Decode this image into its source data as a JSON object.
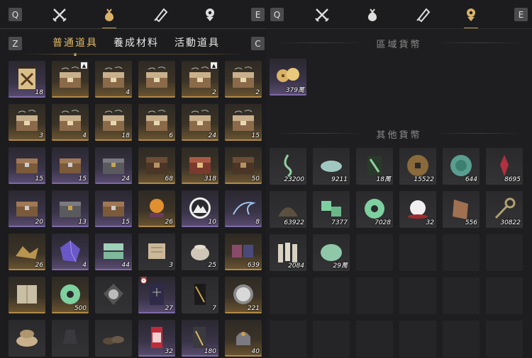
{
  "keys": {
    "prev_left": "Q",
    "next_left": "E",
    "prev_right": "Q",
    "next_right": "E",
    "sub_prev": "Z",
    "sub_next": "C"
  },
  "top_tabs": [
    {
      "icon": "crossed-swords-icon"
    },
    {
      "icon": "money-pouch-icon",
      "active": true
    },
    {
      "icon": "scroll-icon"
    },
    {
      "icon": "gem-icon"
    }
  ],
  "right_top_tabs": [
    {
      "icon": "crossed-swords-icon"
    },
    {
      "icon": "money-pouch-icon"
    },
    {
      "icon": "scroll-icon"
    },
    {
      "icon": "gem-icon",
      "active": true
    }
  ],
  "sub_tabs": [
    {
      "label": "普通道具",
      "active": true
    },
    {
      "label": "養成材料"
    },
    {
      "label": "活動道具"
    }
  ],
  "inventory": [
    [
      {
        "name": "banner",
        "rarity": "purple",
        "count": "18"
      },
      {
        "name": "chest-gold",
        "rarity": "gold",
        "count": "",
        "badge": "▲"
      },
      {
        "name": "chest-gold",
        "rarity": "gold",
        "count": "4"
      },
      {
        "name": "chest-gold",
        "rarity": "gold",
        "count": ""
      },
      {
        "name": "chest-gold",
        "rarity": "gold",
        "count": "2",
        "badge": "▲"
      },
      {
        "name": "chest-gold",
        "rarity": "gold",
        "count": "2"
      }
    ],
    [
      {
        "name": "chest-gold",
        "rarity": "gold",
        "count": "3"
      },
      {
        "name": "chest-gold",
        "rarity": "gold",
        "count": "4"
      },
      {
        "name": "chest-gold",
        "rarity": "gold",
        "count": "18"
      },
      {
        "name": "chest-gold",
        "rarity": "gold",
        "count": "6"
      },
      {
        "name": "chest-gold",
        "rarity": "gold",
        "count": "24"
      },
      {
        "name": "chest-gold",
        "rarity": "gold",
        "count": "15"
      }
    ],
    [
      {
        "name": "chest-wood",
        "rarity": "purple",
        "count": "15"
      },
      {
        "name": "chest-wood",
        "rarity": "purple",
        "count": "15"
      },
      {
        "name": "chest-iron",
        "rarity": "purple",
        "count": "24"
      },
      {
        "name": "chest-dark",
        "rarity": "gold",
        "count": "68"
      },
      {
        "name": "chest-red",
        "rarity": "gold",
        "count": "318"
      },
      {
        "name": "chest-dark",
        "rarity": "gold",
        "count": "50"
      }
    ],
    [
      {
        "name": "chest-wood",
        "rarity": "purple",
        "count": "20"
      },
      {
        "name": "chest-iron",
        "rarity": "purple",
        "count": "13"
      },
      {
        "name": "chest-wood",
        "rarity": "purple",
        "count": "15"
      },
      {
        "name": "orb",
        "rarity": "gold",
        "count": "26"
      },
      {
        "name": "mountain-emblem",
        "rarity": "purple",
        "count": "10"
      },
      {
        "name": "spirit-bird",
        "rarity": "purple",
        "count": "8"
      }
    ],
    [
      {
        "name": "gold-dust",
        "rarity": "gold",
        "count": "26"
      },
      {
        "name": "crystal",
        "rarity": "purple",
        "count": "4"
      },
      {
        "name": "boxes",
        "rarity": "purple",
        "count": "44"
      },
      {
        "name": "scroll-open",
        "rarity": "dark",
        "count": "3"
      },
      {
        "name": "jar",
        "rarity": "dark",
        "count": "25"
      },
      {
        "name": "cases",
        "rarity": "gold",
        "count": "639"
      }
    ],
    [
      {
        "name": "book",
        "rarity": "gold",
        "count": ""
      },
      {
        "name": "jade-ring",
        "rarity": "gold",
        "count": "500"
      },
      {
        "name": "mirror",
        "rarity": "dark",
        "count": ""
      },
      {
        "name": "card-purple",
        "rarity": "purple",
        "count": "27",
        "clock": "⏰"
      },
      {
        "name": "banner-gold",
        "rarity": "dark",
        "count": "7"
      },
      {
        "name": "medal",
        "rarity": "gold",
        "count": "221"
      }
    ],
    [
      {
        "name": "sacks",
        "rarity": "dark",
        "count": ""
      },
      {
        "name": "vase",
        "rarity": "dark",
        "count": ""
      },
      {
        "name": "shoes",
        "rarity": "dark",
        "count": ""
      },
      {
        "name": "red-card",
        "rarity": "purple",
        "count": "32"
      },
      {
        "name": "cards-gold",
        "rarity": "purple",
        "count": "180"
      },
      {
        "name": "bell",
        "rarity": "gold",
        "count": "40"
      }
    ]
  ],
  "right": {
    "region_title": "區域貨幣",
    "region_items": [
      {
        "name": "coins",
        "count": "379萬"
      }
    ],
    "other_title": "其他貨幣",
    "other_items": [
      [
        {
          "name": "green-wisp",
          "count": "23200"
        },
        {
          "name": "jade-fish",
          "count": "9211"
        },
        {
          "name": "green-token",
          "count": "18萬"
        },
        {
          "name": "bronze-coin",
          "count": "15522"
        },
        {
          "name": "jade-disc",
          "count": "644"
        },
        {
          "name": "red-rune",
          "count": "8695"
        }
      ],
      [
        {
          "name": "fan",
          "count": "63922"
        },
        {
          "name": "dice",
          "count": "7377"
        },
        {
          "name": "jade-ring",
          "count": "7028"
        },
        {
          "name": "pearl",
          "count": "32"
        },
        {
          "name": "tablet",
          "count": "556"
        },
        {
          "name": "key",
          "count": "30822"
        }
      ],
      [
        {
          "name": "tallies",
          "count": "2084"
        },
        {
          "name": "jade-stone",
          "count": "29萬"
        }
      ]
    ]
  },
  "colors": {
    "gold": "#c9a250",
    "purple": "#7e6aa8",
    "bg": "#1c1c1e"
  }
}
